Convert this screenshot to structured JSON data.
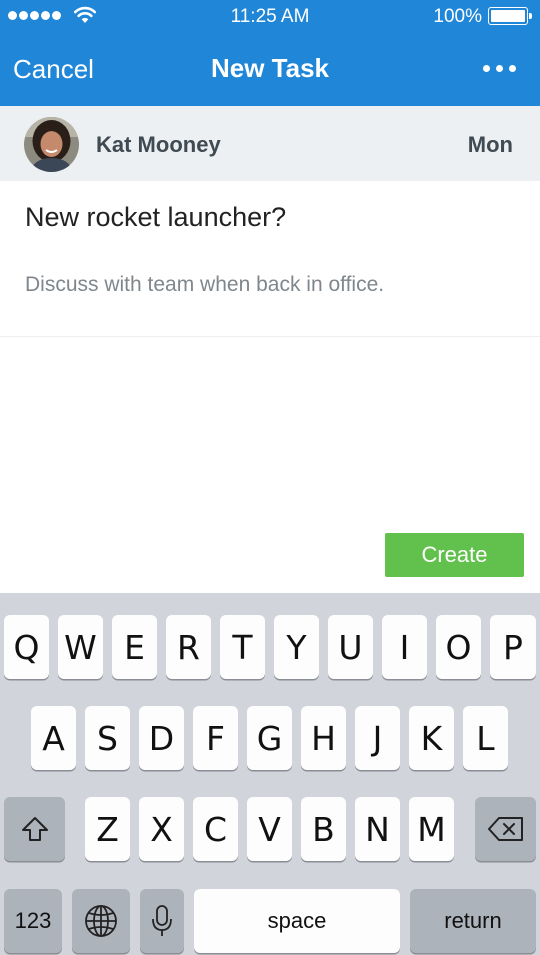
{
  "status_bar": {
    "time": "11:25 AM",
    "battery": "100%"
  },
  "nav": {
    "cancel_label": "Cancel",
    "title": "New Task"
  },
  "assignee": {
    "name": "Kat Mooney",
    "day": "Mon"
  },
  "task": {
    "title": "New rocket launcher?",
    "description": "Discuss with team when back in office."
  },
  "actions": {
    "create_label": "Create"
  },
  "keyboard": {
    "row1": [
      "Q",
      "W",
      "E",
      "R",
      "T",
      "Y",
      "U",
      "I",
      "O",
      "P"
    ],
    "row2": [
      "A",
      "S",
      "D",
      "F",
      "G",
      "H",
      "J",
      "K",
      "L"
    ],
    "row3": [
      "Z",
      "X",
      "C",
      "V",
      "B",
      "N",
      "M"
    ],
    "numbers_label": "123",
    "space_label": "space",
    "return_label": "return"
  },
  "colors": {
    "header_bg": "#1f86d8",
    "create_bg": "#62c14d",
    "user_row_bg": "#edf0f2"
  }
}
